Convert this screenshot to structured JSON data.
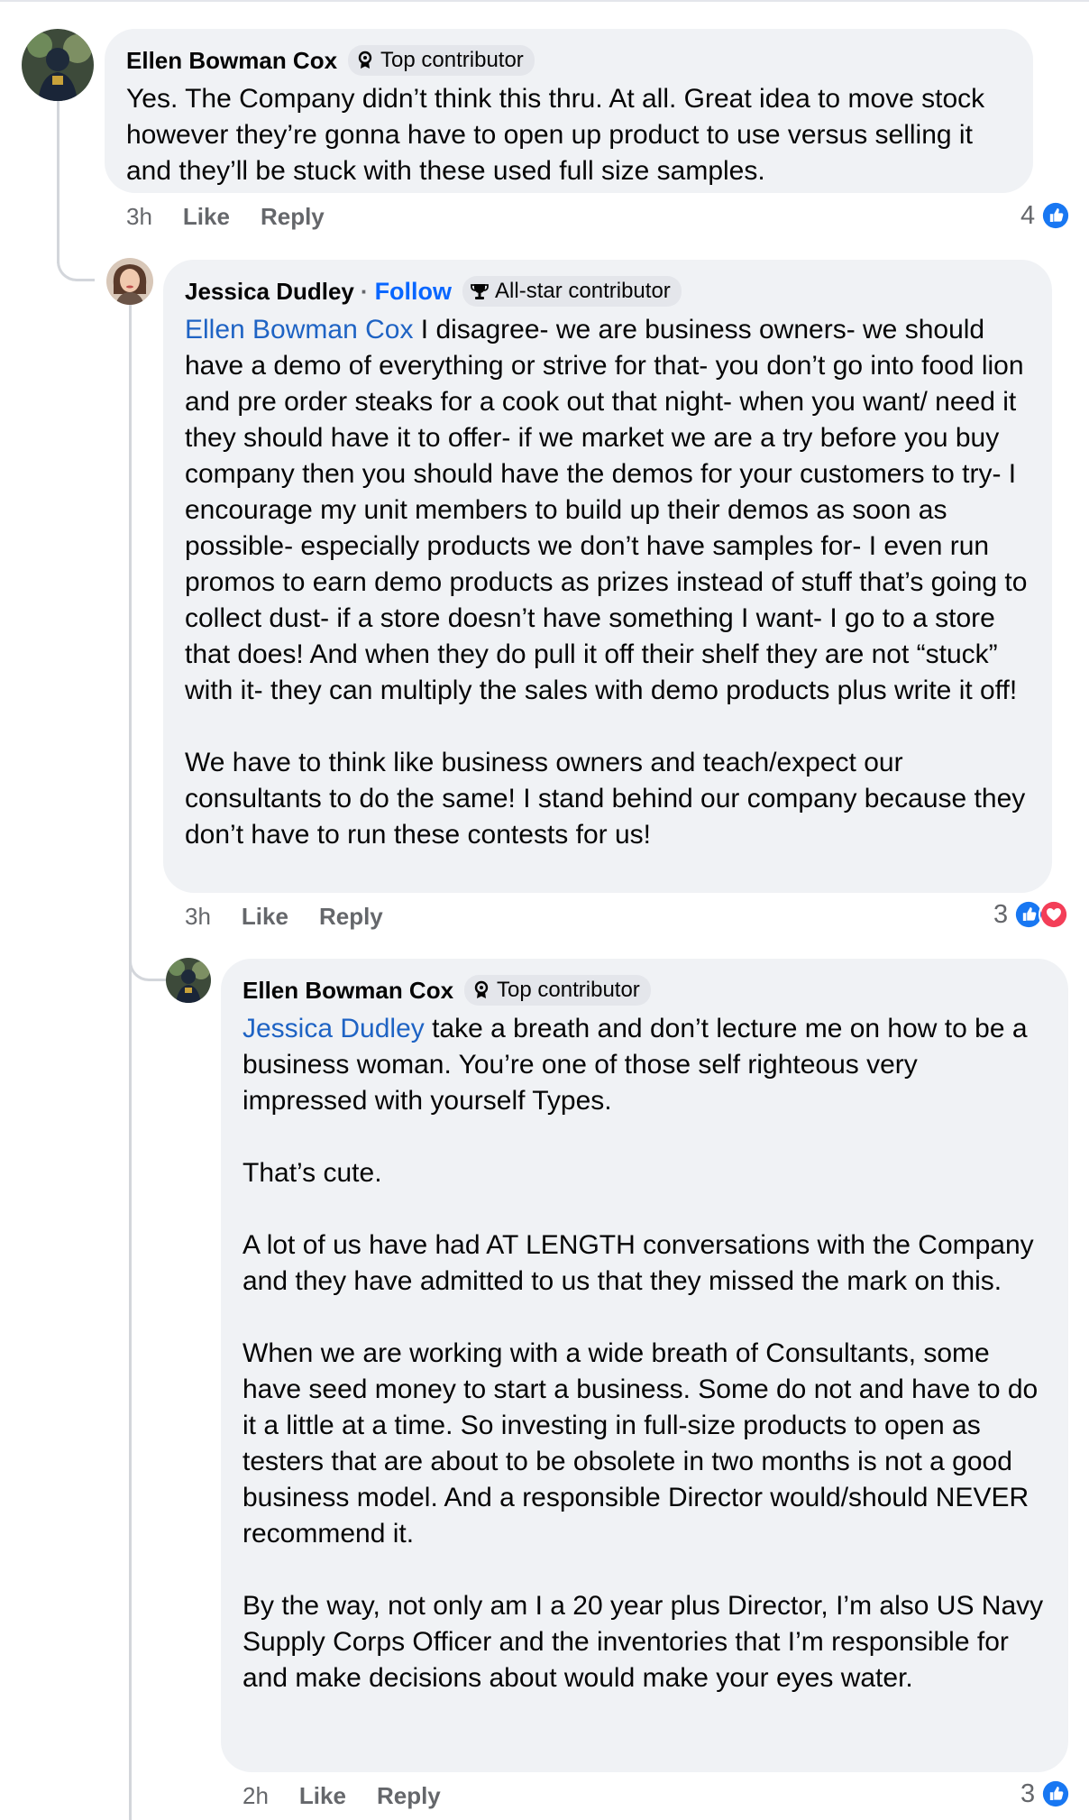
{
  "colors": {
    "like_blue": "#1877f2",
    "love_red": "#f33e58",
    "link_blue": "#1e63c4",
    "follow_blue": "#0866ff",
    "bubble_bg": "#f0f2f5"
  },
  "comments": [
    {
      "author": "Ellen Bowman Cox",
      "badge_icon": "top-contributor-badge-icon",
      "badge": "Top contributor",
      "text": "Yes. The Company didn’t think this thru. At all. Great idea to move stock however they’re gonna have to open up product to use versus selling it and they’ll be stuck with these used full size samples.",
      "time": "3h",
      "like": "Like",
      "reply": "Reply",
      "reactions": {
        "count": "4",
        "icons": [
          "like-icon"
        ]
      }
    },
    {
      "author": "Jessica Dudley",
      "separator": "·",
      "follow": "Follow",
      "badge_icon": "all-star-trophy-icon",
      "badge": "All-star contributor",
      "mention": "Ellen Bowman Cox",
      "text": " I disagree- we are business owners- we should have a demo of everything or strive for that- you don’t go into food lion and pre order steaks for a cook out that night- when you want/ need it they should have it to offer- if we market we are a try before you buy company then you should have the demos for your customers to try- I encourage my unit members to build up their demos as soon as possible- especially products we don’t have samples for- I even run promos to earn demo products as prizes instead of stuff that’s going to collect dust- if a store doesn’t have something I want- I go to a store that does! And when they do pull it off their shelf they are not “stuck” with it- they can multiply the sales with demo products plus write it off!\n\nWe have to think like business owners and teach/expect our consultants to do the same! I stand behind our company because they don’t have to run these contests for us!",
      "time": "3h",
      "like": "Like",
      "reply": "Reply",
      "reactions": {
        "count": "3",
        "icons": [
          "like-icon",
          "love-icon"
        ]
      }
    },
    {
      "author": "Ellen Bowman Cox",
      "badge_icon": "top-contributor-badge-icon",
      "badge": "Top contributor",
      "mention": "Jessica Dudley",
      "text": " take a breath and don’t lecture me on how to be a business woman. You’re one of those self righteous very impressed with yourself Types.\n\nThat’s cute.\n\nA lot of us have had AT LENGTH conversations with the Company and they have admitted to us that they missed the mark on this.\n\nWhen we are working with a wide breath of Consultants, some have seed money to start a business. Some do not and have to do it a little at a time. So investing in full-size products to open as testers that are about to be obsolete in two months is not a good business model. And a responsible Director would/should NEVER recommend it.\n\nBy the way, not only am I a 20 year plus Director, I’m also US Navy Supply Corps Officer and the inventories that I’m responsible for and make decisions about would make your eyes water.",
      "time": "2h",
      "like": "Like",
      "reply": "Reply",
      "reactions": {
        "count": "3",
        "icons": [
          "like-icon"
        ]
      }
    }
  ]
}
